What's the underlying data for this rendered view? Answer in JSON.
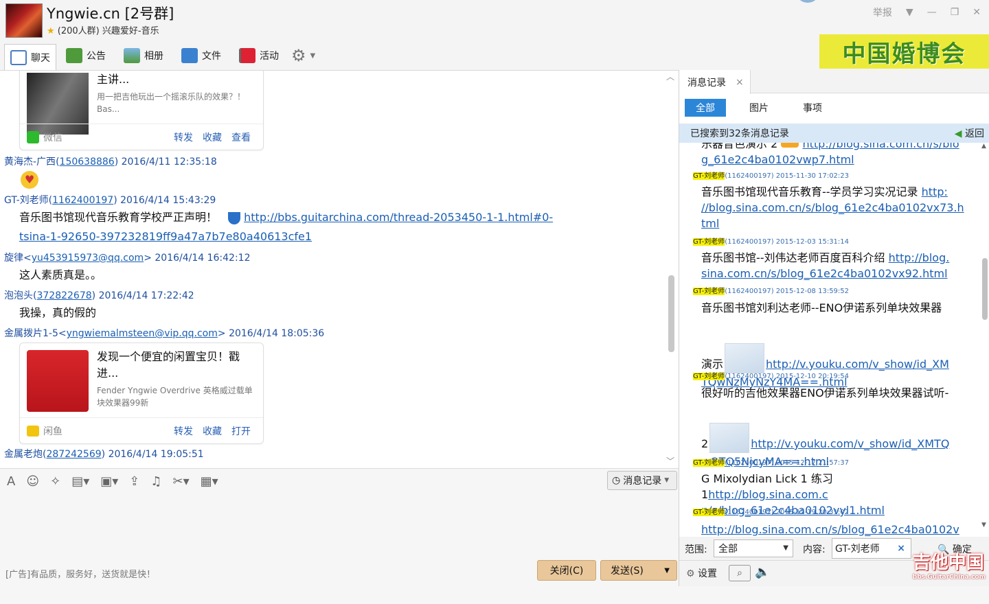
{
  "header": {
    "title": "Yngwie.cn [2号群]",
    "subtitle": "(200人群) 兴趣爱好-音乐",
    "report": "举报"
  },
  "toolbar": {
    "chat": "聊天",
    "notice": "公告",
    "album": "相册",
    "files": "文件",
    "events": "活动"
  },
  "ad_banner": "中国婚博会",
  "chat": {
    "card1": {
      "title": "主讲...",
      "desc": "用一把吉他玩出一个摇滚乐队的效果？！Bas...",
      "source": "微信",
      "actions": [
        "转发",
        "收藏",
        "查看"
      ]
    },
    "m1": {
      "sender": "黄海杰-广西",
      "id": "150638886",
      "time": "2016/4/11 12:35:18"
    },
    "m2": {
      "sender": "GT-刘老师",
      "id": "1162400197",
      "time": "2016/4/14 15:43:29",
      "text": "音乐图书馆现代音乐教育学校严正声明！",
      "link1": "http://bbs.guitarchina.com/thread-2053450-1-1.html#0-",
      "link2": "tsina-1-92650-397232819ff9a47a7b7e80a40613cfe1"
    },
    "m3": {
      "sender": "旋律",
      "email": "yu453915973@qq.com",
      "time": "2016/4/14 16:42:12",
      "text": "这人素质真是。。"
    },
    "m4": {
      "sender": "泡泡头",
      "id": "372822678",
      "time": "2016/4/14 17:22:42",
      "text": "我操，真的假的"
    },
    "m5": {
      "sender": "金属拨片1-5",
      "email": "yngwiemalmsteen@vip.qq.com",
      "time": "2016/4/14 18:05:36"
    },
    "card2": {
      "title": "发现一个便宜的闲置宝贝！戳进...",
      "desc": "Fender Yngwie Overdrive 英格威过载单块效果器99新",
      "source": "闲鱼",
      "actions": [
        "转发",
        "收藏",
        "打开"
      ]
    },
    "m6": {
      "sender": "金属老炮",
      "id": "287242569",
      "time": "2016/4/14 19:05:51"
    }
  },
  "input": {
    "msglog_button": "消息记录",
    "ad_text": "[广告]有品质，服务好，送货就是快！",
    "close_button": "关闭(C)",
    "send_button": "发送(S)"
  },
  "panel": {
    "tab": "消息记录",
    "filters": [
      "全部",
      "图片",
      "事项"
    ],
    "found": "已搜索到32条消息记录",
    "back": "返回",
    "records": [
      {
        "top": "乐器音色演示 2",
        "link": "http://blog.sina.com.cn/s/blo",
        "link2": "g_61e2c4ba0102vwp7.html"
      },
      {
        "name": "GT-刘老师",
        "meta": "(1162400197) 2015-11-30 17:02:23",
        "text": "音乐图书馆现代音乐教育--学员学习实况记录",
        "link": "http:",
        "link2": "//blog.sina.com.cn/s/blog_61e2c4ba0102vx73.h",
        "link3": "tml"
      },
      {
        "name": "GT-刘老师",
        "meta": "(1162400197) 2015-12-03 15:31:14",
        "text": "音乐图书馆--刘伟达老师百度百科介绍",
        "link": "http://blog.",
        "link2": "sina.com.cn/s/blog_61e2c4ba0102vx92.html"
      },
      {
        "name": "GT-刘老师",
        "meta": "(1162400197) 2015-12-08 13:59:52",
        "text": "音乐图书馆刘利达老师--ENO伊诺系列单块效果器",
        "text2": "演示",
        "link": "http://v.youku.com/v_show/id_XM",
        "link2": "TQwNzMyNzY4MA==.html"
      },
      {
        "name": "GT-刘老师",
        "meta": "(1162400197) 2015-12-10 20:19:54",
        "text": "很好听的吉他效果器ENO伊诺系列单块效果器试听-",
        "text2": "2",
        "link": "http://v.youku.com/v_show/id_XMTQ",
        "link2": "wOTQ5NjcyMA==.html"
      },
      {
        "name": "GT-刘老师",
        "meta": "(1162400197) 2015-12-17 21:57:37",
        "text": "G Mixolydian Lick 1 练习 1",
        "link": "http://blog.sina.com.c",
        "link2": "n/s/blog_61e2c4ba0102vyl1.html"
      },
      {
        "name": "GT-刘老师",
        "meta": "(1162400197) 2015-12-19 20:31:02",
        "link": "http://blog.sina.com.cn/s/blog_61e2c4ba0102v"
      }
    ],
    "range_label": "范围:",
    "range_value": "全部",
    "content_label": "内容:",
    "content_value": "GT-刘老师",
    "confirm": "确定",
    "settings": "设置"
  },
  "watermark": {
    "main": "吉他中国",
    "sub": "bbs.GuitarChina.com"
  },
  "colors": {
    "accent": "#2c86d8",
    "link": "#1a5fb4",
    "highlight": "#f5ef00",
    "button": "#e9c79a"
  }
}
